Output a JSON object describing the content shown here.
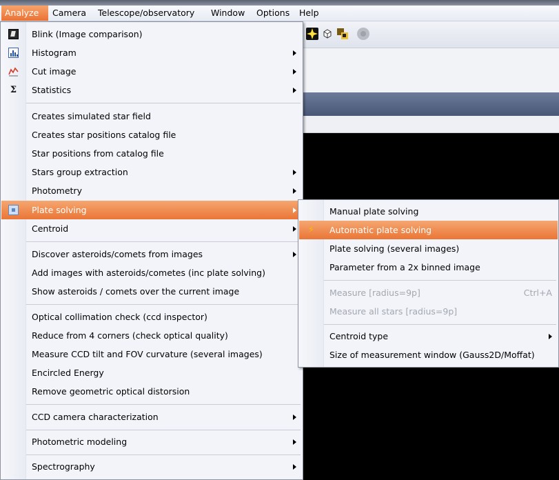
{
  "menubar": {
    "items": [
      {
        "label": "Analyze",
        "active": true
      },
      {
        "label": "Camera"
      },
      {
        "label": "Telescope/observatory"
      },
      {
        "label": "Window"
      },
      {
        "label": "Options"
      },
      {
        "label": "Help"
      }
    ]
  },
  "analyze_menu": {
    "items": {
      "blink": "Blink (Image comparison)",
      "histogram": "Histogram",
      "cut_image": "Cut image",
      "statistics": "Statistics",
      "simulated_star_field": "Creates simulated star field",
      "star_positions_catalog_file": "Creates star positions catalog file",
      "star_positions_from_catalog": "Star positions from catalog file",
      "stars_group_extraction": "Stars group extraction",
      "photometry": "Photometry",
      "plate_solving": "Plate solving",
      "centroid": "Centroid",
      "discover_asteroids": "Discover asteroids/comets from images",
      "add_images_asteroids": "Add images with asteroids/cometes (inc plate solving)",
      "show_asteroids": "Show asteroids / comets over the current image",
      "optical_collimation": "Optical collimation check (ccd inspector)",
      "reduce_4_corners": "Reduce from 4 corners (check optical quality)",
      "measure_ccd_tilt": "Measure CCD tilt and FOV curvature (several images)",
      "encircled_energy": "Encircled Energy",
      "remove_distorsion": "Remove geometric optical distorsion",
      "ccd_characterization": "CCD camera characterization",
      "photometric_modeling": "Photometric modeling",
      "spectrography": "Spectrography"
    }
  },
  "plate_solving_submenu": {
    "items": {
      "manual": "Manual plate solving",
      "automatic": "Automatic plate solving",
      "several_images": "Plate solving (several images)",
      "binned": "Parameter from a 2x binned image",
      "measure": "Measure [radius=9p]",
      "measure_shortcut": "Ctrl+A",
      "measure_all": "Measure all stars [radius=9p]",
      "centroid_type": "Centroid type",
      "window_size": "Size of measurement window (Gauss2D/Moffat)"
    }
  },
  "colors": {
    "highlight": "#ea7536",
    "menu_background": "#f2f4f9",
    "canvas": "#000000"
  }
}
